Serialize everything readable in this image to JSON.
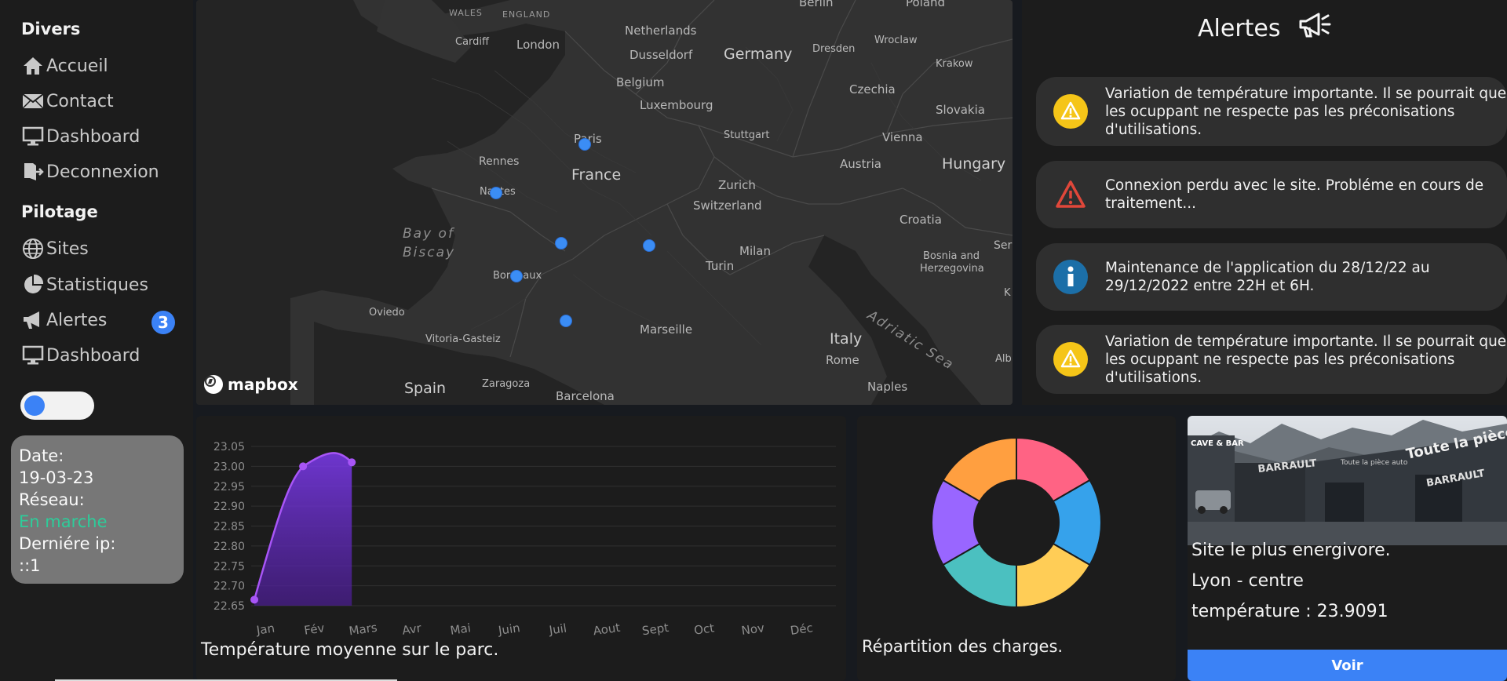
{
  "sidebar": {
    "divers_title": "Divers",
    "divers_items": [
      {
        "label": "Accueil",
        "icon": "home-icon"
      },
      {
        "label": "Contact",
        "icon": "envelope-icon"
      },
      {
        "label": "Dashboard",
        "icon": "monitor-icon"
      },
      {
        "label": "Deconnexion",
        "icon": "logout-icon"
      }
    ],
    "pilotage_title": "Pilotage",
    "pilotage_items": [
      {
        "label": "Sites",
        "icon": "globe-icon"
      },
      {
        "label": "Statistiques",
        "icon": "pie-chart-icon"
      },
      {
        "label": "Alertes",
        "icon": "megaphone-icon"
      },
      {
        "label": "Dashboard",
        "icon": "monitor-icon"
      }
    ],
    "alert_badge": "3",
    "toggle_on": true
  },
  "info": {
    "date_label": "Date:",
    "date_value": "19-03-23",
    "network_label": "Réseau:",
    "network_value": "En marche",
    "ip_label": "Derniére ip:",
    "ip_value": "::1"
  },
  "map": {
    "attribution": "mapbox",
    "labels": {
      "wales": "WALES",
      "england": "ENGLAND",
      "berlin": "Berlin",
      "poland": "Poland",
      "cardiff": "Cardiff",
      "london": "London",
      "netherlands": "Netherlands",
      "dusseldorf": "Dusseldorf",
      "germany": "Germany",
      "dresden": "Dresden",
      "wroclaw": "Wroclaw",
      "belgium": "Belgium",
      "luxembourg": "Luxembourg",
      "czechia": "Czechia",
      "krakow": "Krakow",
      "slovakia": "Slovakia",
      "paris": "Paris",
      "stuttgart": "Stuttgart",
      "vienna": "Vienna",
      "rennes": "Rennes",
      "france": "France",
      "austria": "Austria",
      "hungary": "Hungary",
      "zurich": "Zurich",
      "switzerland": "Switzerland",
      "nantes": "Nantes",
      "croatia": "Croatia",
      "bay": "Bay of",
      "biscay": "Biscay",
      "turin": "Turin",
      "milan": "Milan",
      "bosnia": "Bosnia and",
      "herzegovina": "Herzegovina",
      "ser": "Ser",
      "bordeaux": "Bordeaux",
      "oviedo": "Oviedo",
      "adriatic": "Adriatic Sea",
      "vitoria": "Vitoria-Gasteiz",
      "marseille": "Marseille",
      "italy": "Italy",
      "rome": "Rome",
      "alb": "Alb",
      "spain": "Spain",
      "zaragoza": "Zaragoza",
      "barcelona": "Barcelona",
      "naples": "Naples",
      "k": "K"
    }
  },
  "alerts": {
    "title": "Alertes",
    "items": [
      {
        "type": "warning",
        "icon": "warning-icon",
        "text": "Variation de température importante. Il se pourrait que les ocuppant ne respecte pas les préconisations d'utilisations."
      },
      {
        "type": "danger",
        "icon": "danger-icon",
        "text": "Connexion perdu avec le site. Probléme en cours de traitement..."
      },
      {
        "type": "info",
        "icon": "info-icon",
        "text": "Maintenance de l'application du 28/12/22 au 29/12/2022 entre 22H et 6H."
      },
      {
        "type": "warning",
        "icon": "warning-icon",
        "text": "Variation de température importante. Il se pourrait que les ocuppant ne respecte pas les préconisations d'utilisations."
      }
    ]
  },
  "chart_data": [
    {
      "type": "area",
      "title": "Température moyenne sur le parc.",
      "categories": [
        "Jan",
        "Fév",
        "Mars",
        "Avr",
        "Mai",
        "Juin",
        "Juil",
        "Aout",
        "Sept",
        "Oct",
        "Nov",
        "Déc"
      ],
      "values": [
        22.665,
        23.0,
        23.01
      ],
      "ylim": [
        22.65,
        23.05
      ],
      "yticks": [
        "23.05",
        "23.00",
        "22.95",
        "22.90",
        "22.85",
        "22.80",
        "22.75",
        "22.70",
        "22.65"
      ],
      "color": "#a855f7",
      "grid": true
    },
    {
      "type": "pie",
      "title": "Répartition des charges.",
      "donut": true,
      "values": [
        1,
        1,
        1,
        1,
        1,
        1
      ],
      "colors": [
        "#ff6384",
        "#36a2eb",
        "#ffcd56",
        "#4bc0c0",
        "#9966ff",
        "#ff9f40"
      ]
    }
  ],
  "site": {
    "headline": "Site le plus energivore.",
    "name": "Lyon - centre",
    "temperature": "température : 23.9091",
    "button": "Voir",
    "photo_texts": {
      "shop_sign": "Toute la pièce auto",
      "brand": "BARRAULT",
      "brand_small": "BARRAULT",
      "sign_small": "Toute la pièce auto",
      "cave": "CAVE & BAR"
    }
  }
}
